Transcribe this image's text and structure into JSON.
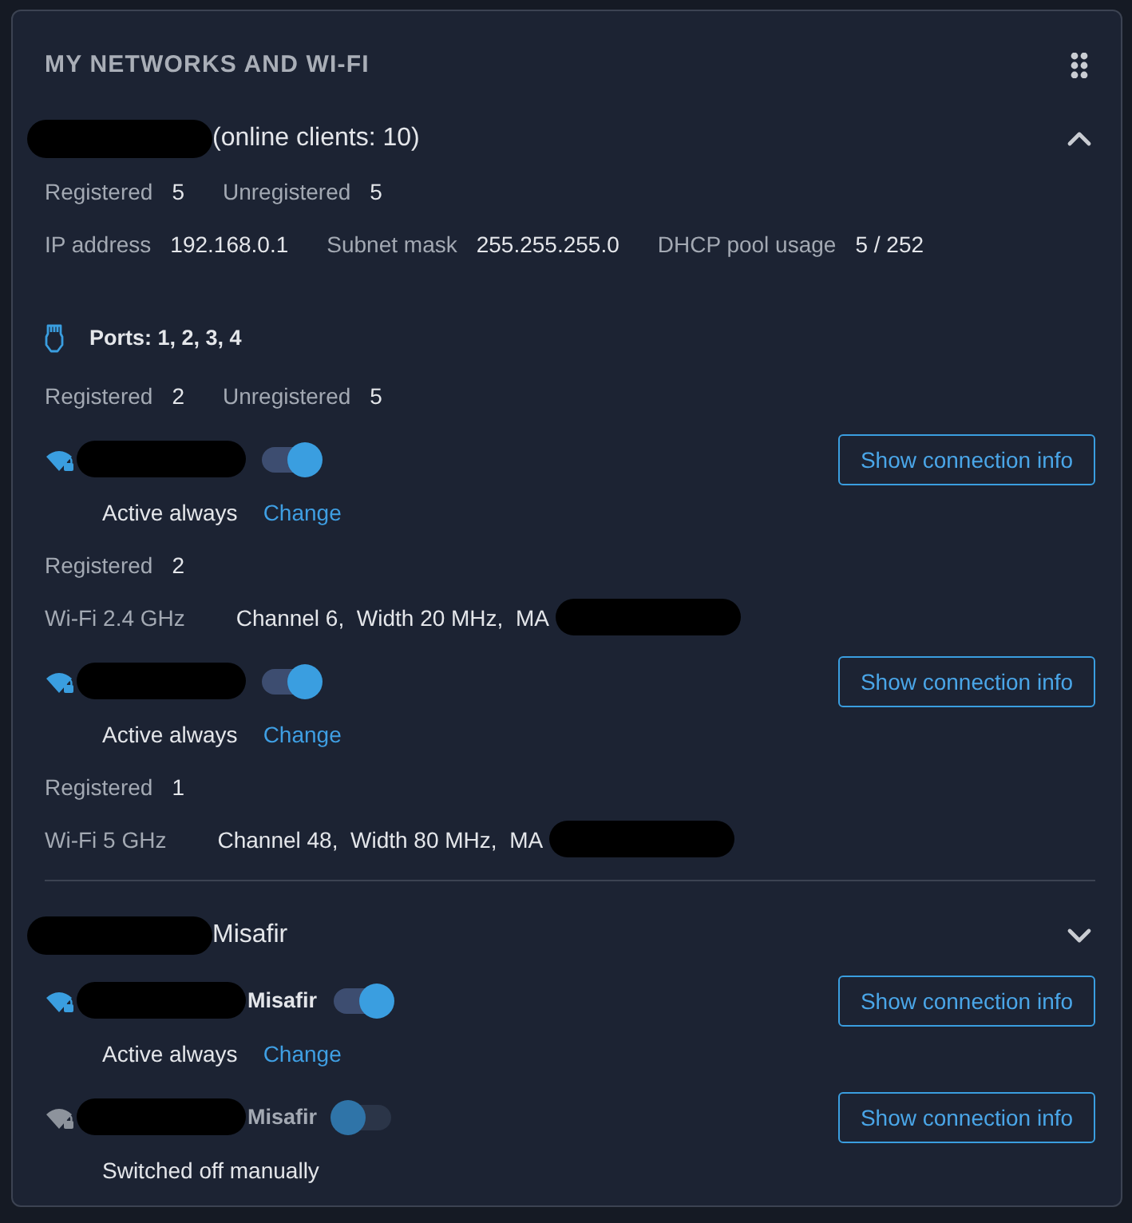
{
  "title": "MY NETWORKS AND WI-FI",
  "networks": [
    {
      "name": "(online clients: 10)",
      "expanded": true,
      "stats": [
        [
          {
            "label": "Registered",
            "value": "5"
          },
          {
            "label": "Unregistered",
            "value": "5"
          }
        ],
        [
          {
            "label": "IP address",
            "value": "192.168.0.1"
          },
          {
            "label": "Subnet mask",
            "value": "255.255.255.0"
          },
          {
            "label": "DHCP pool usage",
            "value": "5 / 252"
          }
        ]
      ],
      "ports": "Ports: 1, 2, 3, 4",
      "port_stats": [
        {
          "label": "Registered",
          "value": "2"
        },
        {
          "label": "Unregistered",
          "value": "5"
        }
      ],
      "wifi": [
        {
          "on": true,
          "status": "Active always",
          "link": "Change",
          "button": "Show connection info",
          "stats": [
            {
              "label": "Registered",
              "value": "2"
            }
          ],
          "band": "Wi-Fi 2.4 GHz",
          "details": "Channel 6,  Width 20 MHz,  MA"
        },
        {
          "on": true,
          "status": "Active always",
          "link": "Change",
          "button": "Show connection info",
          "stats": [
            {
              "label": "Registered",
              "value": "1"
            }
          ],
          "band": "Wi-Fi 5 GHz",
          "details": "Channel 48,  Width 80 MHz,  MA"
        }
      ]
    },
    {
      "name": "Misafir",
      "expanded": false,
      "wifi": [
        {
          "name": "Misafir",
          "on": true,
          "status": "Active always",
          "link": "Change",
          "button": "Show connection info"
        },
        {
          "name": "Misafir",
          "on": false,
          "status": "Switched off manually",
          "button": "Show connection info"
        }
      ]
    }
  ]
}
